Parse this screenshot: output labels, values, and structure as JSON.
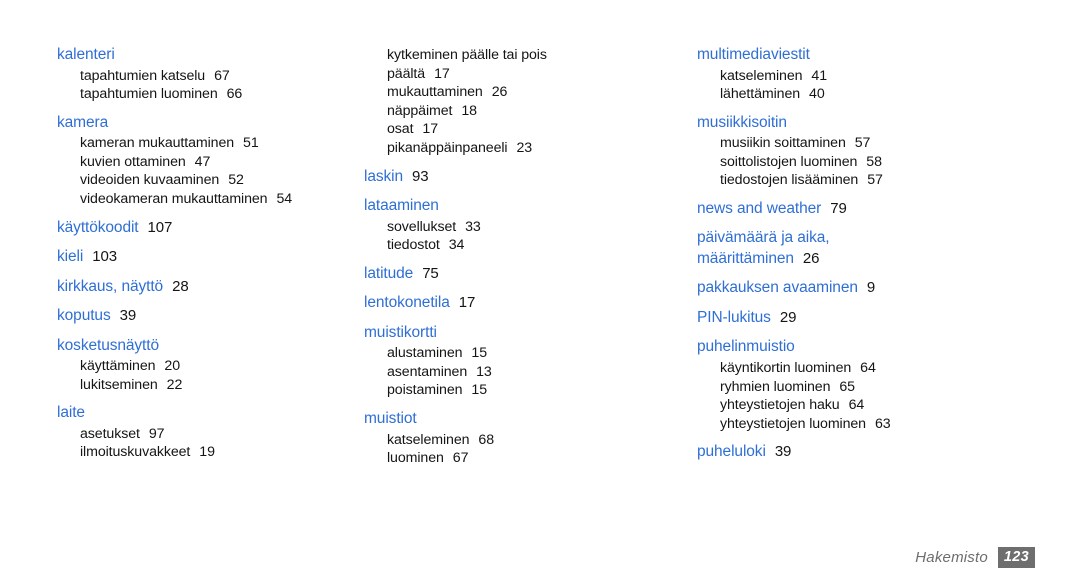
{
  "document": {
    "type": "index",
    "language": "fi",
    "heading_color": "#2f6fd4",
    "text_color": "#151515",
    "background_color": "#ffffff"
  },
  "columns": [
    {
      "id": "column-1",
      "groups": [
        {
          "heading": "kalenteri",
          "heading_page": "",
          "subs": [
            {
              "label": "tapahtumien katselu",
              "page": "67"
            },
            {
              "label": "tapahtumien luominen",
              "page": "66"
            }
          ]
        },
        {
          "heading": "kamera",
          "heading_page": "",
          "subs": [
            {
              "label": "kameran mukauttaminen",
              "page": "51"
            },
            {
              "label": "kuvien ottaminen",
              "page": "47"
            },
            {
              "label": "videoiden kuvaaminen",
              "page": "52"
            },
            {
              "label": "videokameran mukauttaminen",
              "page": "54"
            }
          ]
        },
        {
          "heading": "käyttökoodit",
          "heading_page": "107",
          "subs": []
        },
        {
          "heading": "kieli",
          "heading_page": "103",
          "subs": []
        },
        {
          "heading": "kirkkaus, näyttö",
          "heading_page": "28",
          "subs": []
        },
        {
          "heading": "koputus",
          "heading_page": "39",
          "subs": []
        },
        {
          "heading": "kosketusnäyttö",
          "heading_page": "",
          "subs": [
            {
              "label": "käyttäminen",
              "page": "20"
            },
            {
              "label": "lukitseminen",
              "page": "22"
            }
          ]
        },
        {
          "heading": "laite",
          "heading_page": "",
          "subs": [
            {
              "label": "asetukset",
              "page": "97"
            },
            {
              "label": "ilmoituskuvakkeet",
              "page": "19"
            }
          ]
        }
      ]
    },
    {
      "id": "column-2",
      "groups": [
        {
          "heading": "",
          "heading_page": "",
          "subs": [
            {
              "label": "kytkeminen päälle tai pois",
              "label_line2": "päältä",
              "page": "17"
            },
            {
              "label": "mukauttaminen",
              "page": "26"
            },
            {
              "label": "näppäimet",
              "page": "18"
            },
            {
              "label": "osat",
              "page": "17"
            },
            {
              "label": "pikanäppäinpaneeli",
              "page": "23"
            }
          ]
        },
        {
          "heading": "laskin",
          "heading_page": "93",
          "subs": []
        },
        {
          "heading": "lataaminen",
          "heading_page": "",
          "subs": [
            {
              "label": "sovellukset",
              "page": "33"
            },
            {
              "label": "tiedostot",
              "page": "34"
            }
          ]
        },
        {
          "heading": "latitude",
          "heading_page": "75",
          "subs": []
        },
        {
          "heading": "lentokonetila",
          "heading_page": "17",
          "subs": []
        },
        {
          "heading": "muistikortti",
          "heading_page": "",
          "subs": [
            {
              "label": "alustaminen",
              "page": "15"
            },
            {
              "label": "asentaminen",
              "page": "13"
            },
            {
              "label": "poistaminen",
              "page": "15"
            }
          ]
        },
        {
          "heading": "muistiot",
          "heading_page": "",
          "subs": [
            {
              "label": "katseleminen",
              "page": "68"
            },
            {
              "label": "luominen",
              "page": "67"
            }
          ]
        }
      ]
    },
    {
      "id": "column-3",
      "groups": [
        {
          "heading": "multimediaviestit",
          "heading_page": "",
          "subs": [
            {
              "label": "katseleminen",
              "page": "41"
            },
            {
              "label": "lähettäminen",
              "page": "40"
            }
          ]
        },
        {
          "heading": "musiikkisoitin",
          "heading_page": "",
          "subs": [
            {
              "label": "musiikin soittaminen",
              "page": "57"
            },
            {
              "label": "soittolistojen luominen",
              "page": "58"
            },
            {
              "label": "tiedostojen lisääminen",
              "page": "57"
            }
          ]
        },
        {
          "heading": "news and weather",
          "heading_page": "79",
          "subs": []
        },
        {
          "heading": "päivämäärä ja aika,",
          "heading_line2": "määrittäminen",
          "heading_page": "26",
          "subs": []
        },
        {
          "heading": "pakkauksen avaaminen",
          "heading_page": "9",
          "subs": []
        },
        {
          "heading": "PIN-lukitus",
          "heading_page": "29",
          "subs": []
        },
        {
          "heading": "puhelinmuistio",
          "heading_page": "",
          "subs": [
            {
              "label": "käyntikortin luominen",
              "page": "64"
            },
            {
              "label": "ryhmien luominen",
              "page": "65"
            },
            {
              "label": "yhteystietojen haku",
              "page": "64"
            },
            {
              "label": "yhteystietojen luominen",
              "page": "63"
            }
          ]
        },
        {
          "heading": "puheluloki",
          "heading_page": "39",
          "subs": []
        }
      ]
    }
  ],
  "footer": {
    "label": "Hakemisto",
    "page_number": "123",
    "badge_color": "#6e6e6e",
    "label_color": "#6d6d6d"
  }
}
